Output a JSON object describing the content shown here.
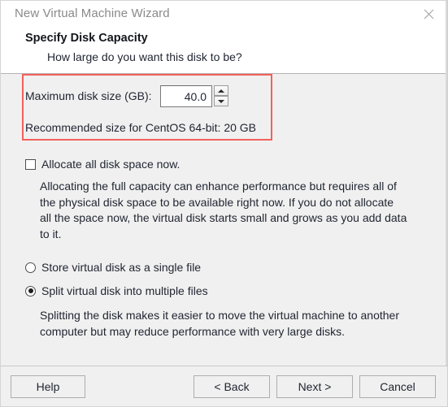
{
  "window": {
    "title": "New Virtual Machine Wizard",
    "close_icon": "close-icon"
  },
  "header": {
    "title": "Specify Disk Capacity",
    "subtitle": "How large do you want this disk to be?"
  },
  "disk": {
    "max_size_label": "Maximum disk size (GB):",
    "max_size_value": "40.0",
    "spin_up_icon": "chevron-up-icon",
    "spin_down_icon": "chevron-down-icon",
    "recommended_text": "Recommended size for CentOS 64-bit: 20 GB",
    "highlight_color": "#f4615c"
  },
  "allocate": {
    "checkbox_label": "Allocate all disk space now.",
    "checked": false,
    "description": "Allocating the full capacity can enhance performance but requires all of the physical disk space to be available right now. If you do not allocate all the space now, the virtual disk starts small and grows as you add data to it."
  },
  "storage": {
    "options": [
      {
        "label": "Store virtual disk as a single file",
        "selected": false
      },
      {
        "label": "Split virtual disk into multiple files",
        "selected": true
      }
    ],
    "description": "Splitting the disk makes it easier to move the virtual machine to another computer but may reduce performance with very large disks."
  },
  "footer": {
    "help": "Help",
    "back": "< Back",
    "next": "Next >",
    "cancel": "Cancel"
  }
}
